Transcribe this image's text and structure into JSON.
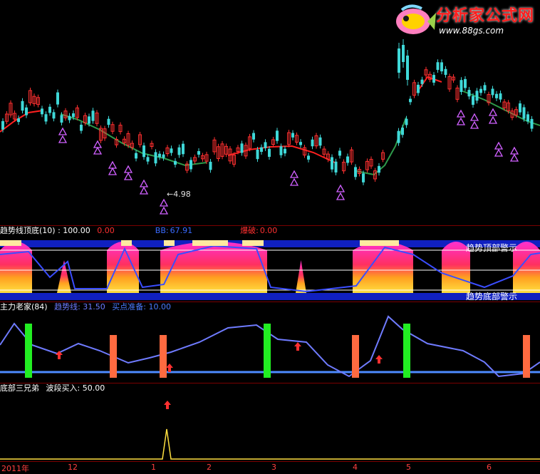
{
  "logo": {
    "title": "分析家公式网",
    "url": "www.88gs.com"
  },
  "price_pane": {
    "low_marker": "4.98"
  },
  "pane1": {
    "indicator": "趋势线顶底(10) : 100.00",
    "value2": "0.00",
    "value3_label": "BB:",
    "value3": "67.91",
    "value4_label": "爆破:",
    "value4": "0.00",
    "overlay_top": "趋势顶部警示",
    "overlay_bottom": "趋势底部警示",
    "colors": {
      "indicator": "#ffffff",
      "value2": "#ff3030",
      "value3": "#3a6bff",
      "value4": "#ff3030"
    }
  },
  "pane2": {
    "indicator": "主力老家(84)",
    "line_label": "趋势线: 31.50",
    "buy_label": "买点准备: 10.00",
    "colors": {
      "indicator": "#ffffff",
      "line_label": "#6f7bff",
      "buy_label": "#4d7bff"
    }
  },
  "pane3": {
    "indicator": "底部三兄弟",
    "buy_label": "波段买入: 50.00"
  },
  "axis": {
    "labels": [
      "2011年",
      "12",
      "1",
      "2",
      "3",
      "4",
      "5",
      "6"
    ]
  }
}
